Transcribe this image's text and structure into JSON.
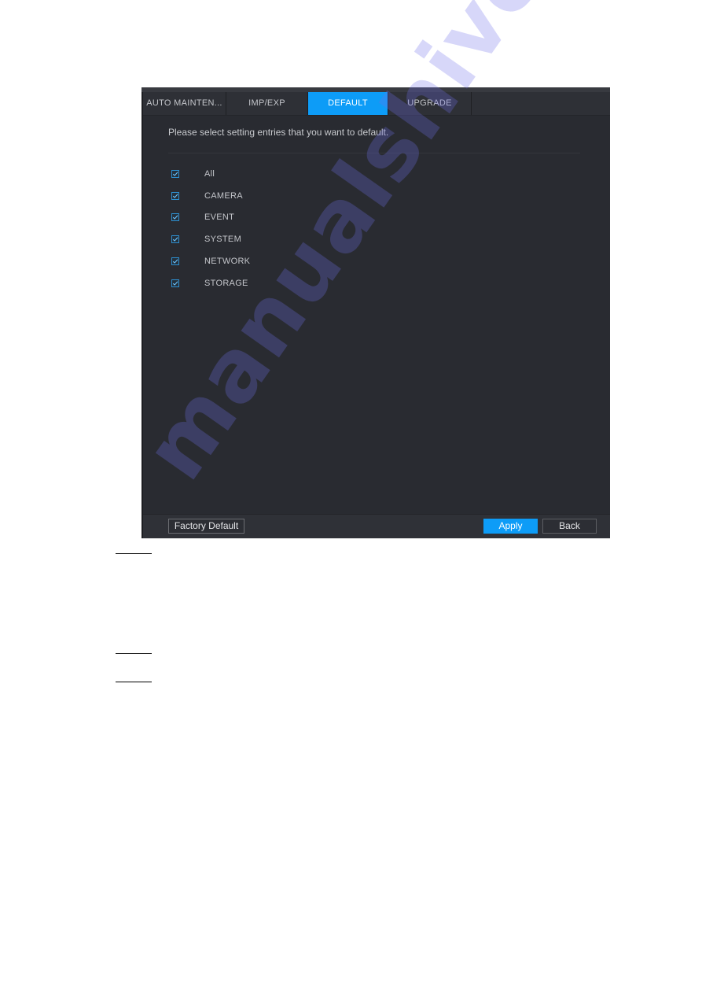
{
  "tabs": [
    {
      "label": "AUTO MAINTEN...",
      "active": false
    },
    {
      "label": "IMP/EXP",
      "active": false
    },
    {
      "label": "DEFAULT",
      "active": true
    },
    {
      "label": "UPGRADE",
      "active": false
    }
  ],
  "content": {
    "instruction": "Please select setting entries that you want to default.",
    "options": [
      {
        "label": "All",
        "checked": true
      },
      {
        "label": "CAMERA",
        "checked": true
      },
      {
        "label": "EVENT",
        "checked": true
      },
      {
        "label": "SYSTEM",
        "checked": true
      },
      {
        "label": "NETWORK",
        "checked": true
      },
      {
        "label": "STORAGE",
        "checked": true
      }
    ]
  },
  "footer": {
    "factory_default_label": "Factory Default",
    "apply_label": "Apply",
    "back_label": "Back"
  },
  "watermark": {
    "text": "manualshive.com"
  },
  "colors": {
    "accent": "#0d9cf7",
    "panel_bg": "#292b31",
    "checkbox_border": "#2d8fd0"
  }
}
